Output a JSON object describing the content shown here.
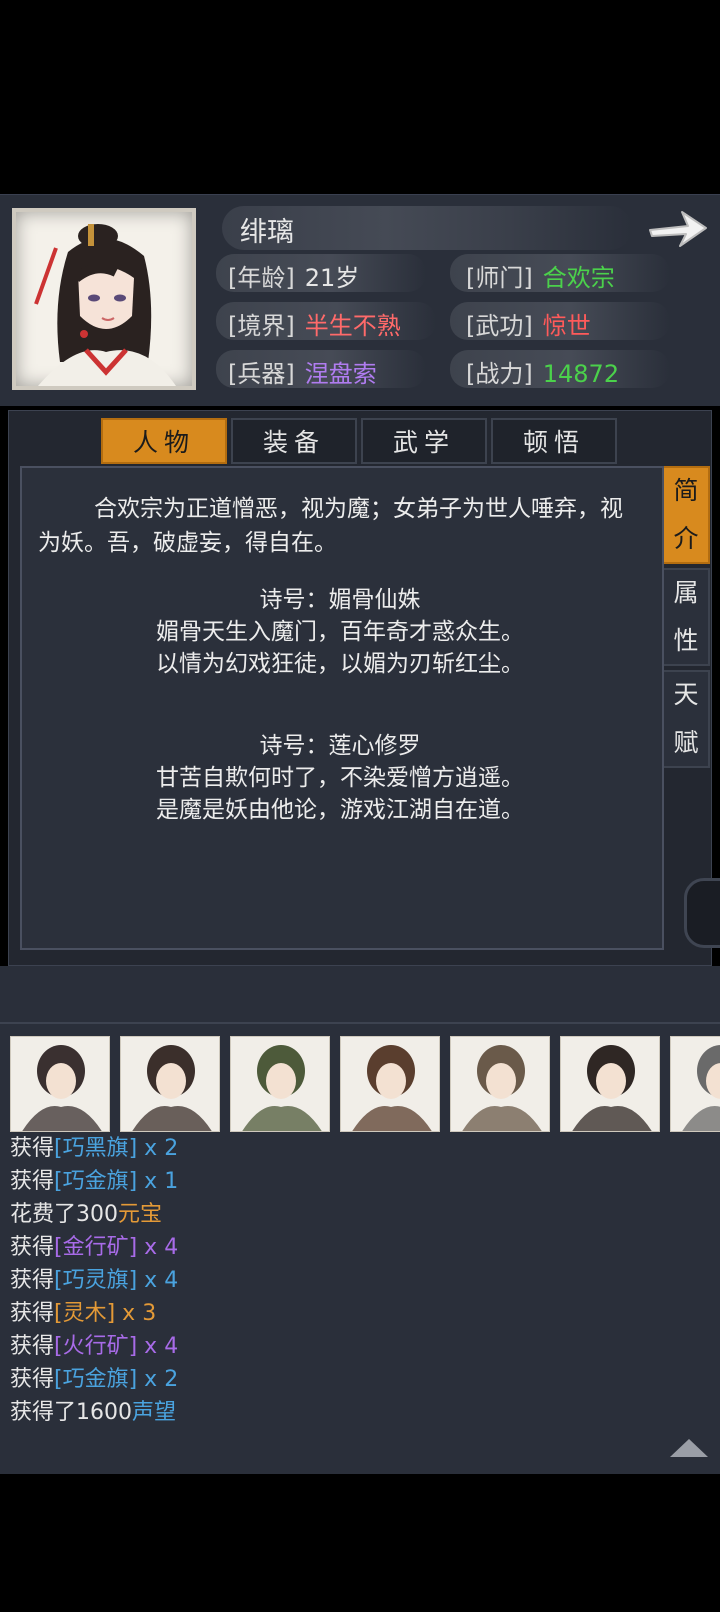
{
  "character": {
    "name": "绯璃",
    "stats": [
      {
        "label": "[年龄]",
        "value": "21岁",
        "color": "#e6e6e6"
      },
      {
        "label": "[师门]",
        "value": "合欢宗",
        "color": "#4bd14b"
      },
      {
        "label": "[境界]",
        "value": "半生不熟",
        "color": "#ff6a6a"
      },
      {
        "label": "[武功]",
        "value": "惊世",
        "color": "#ff5a5a"
      },
      {
        "label": "[兵器]",
        "value": "涅盘索",
        "color": "#b07cf0"
      },
      {
        "label": "[战力]",
        "value": "14872",
        "color": "#4bd14b"
      }
    ]
  },
  "tabs": [
    {
      "label": "人物",
      "active": true
    },
    {
      "label": "装备",
      "active": false
    },
    {
      "label": "武学",
      "active": false
    },
    {
      "label": "顿悟",
      "active": false
    }
  ],
  "side_tabs": [
    {
      "label": "简介",
      "active": true
    },
    {
      "label": "属性",
      "active": false
    },
    {
      "label": "天赋",
      "active": false
    }
  ],
  "intro": "合欢宗为正道憎恶，视为魔；女弟子为世人唾弃，视为妖。吾，破虚妄，得自在。",
  "poems": [
    {
      "title": "诗号：媚骨仙姝",
      "line1": "媚骨天生入魔门，百年奇才惑众生。",
      "line2": "以情为幻戏狂徒，以媚为刃斩红尘。"
    },
    {
      "title": "诗号：莲心修罗",
      "line1": "甘苦自欺何时了，不染爱憎方逍遥。",
      "line2": "是魔是妖由他论，游戏江湖自在道。"
    }
  ],
  "log": [
    {
      "prefix": "获得",
      "item": "[巧黑旗]",
      "qty": " x 2",
      "color": "blue"
    },
    {
      "prefix": "获得",
      "item": "[巧金旗]",
      "qty": " x 1",
      "color": "blue"
    },
    {
      "prefix": "花费了300",
      "item": "元宝",
      "qty": "",
      "color": "orange"
    },
    {
      "prefix": "获得",
      "item": "[金行矿]",
      "qty": " x 4",
      "color": "purple"
    },
    {
      "prefix": "获得",
      "item": "[巧灵旗]",
      "qty": " x 4",
      "color": "blue"
    },
    {
      "prefix": "获得",
      "item": "[灵木]",
      "qty": " x 3",
      "color": "orange"
    },
    {
      "prefix": "获得",
      "item": "[火行矿]",
      "qty": " x 4",
      "color": "purple"
    },
    {
      "prefix": "获得",
      "item": "[巧金旗]",
      "qty": " x 2",
      "color": "blue"
    },
    {
      "prefix": "获得了1600",
      "item": "声望",
      "qty": "",
      "color": "blue"
    }
  ],
  "roster_count": 7,
  "accent": "#d88a1e"
}
